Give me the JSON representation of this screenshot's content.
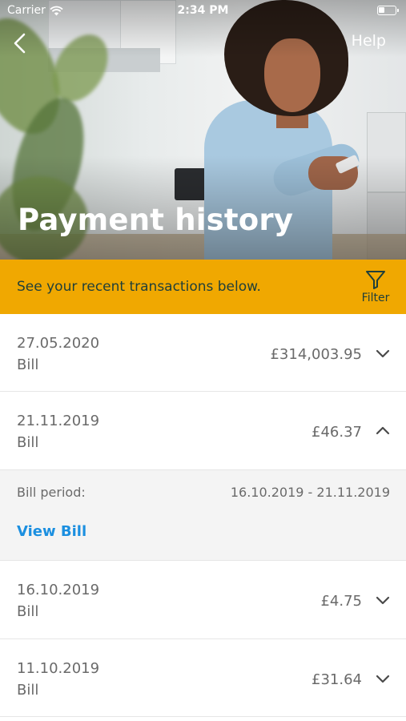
{
  "status_bar": {
    "carrier": "Carrier",
    "time": "2:34 PM"
  },
  "header": {
    "help_label": "Help",
    "title": "Payment history"
  },
  "banner": {
    "message": "See your recent transactions below.",
    "filter_label": "Filter"
  },
  "transactions": [
    {
      "date": "27.05.2020",
      "type": "Bill",
      "amount": "£314,003.95",
      "expanded": false
    },
    {
      "date": "21.11.2019",
      "type": "Bill",
      "amount": "£46.37",
      "expanded": true,
      "detail": {
        "period_label": "Bill period:",
        "period_value": "16.10.2019 - 21.11.2019",
        "link_label": "View Bill"
      }
    },
    {
      "date": "16.10.2019",
      "type": "Bill",
      "amount": "£4.75",
      "expanded": false
    },
    {
      "date": "11.10.2019",
      "type": "Bill",
      "amount": "£31.64",
      "expanded": false
    }
  ],
  "colors": {
    "banner": "#f0a801",
    "banner_text": "#1f3f3a",
    "link": "#1b8fe0",
    "detail_bg": "#f4f4f4"
  },
  "icons": {
    "back": "chevron-left-icon",
    "filter": "funnel-icon",
    "wifi": "wifi-icon",
    "battery": "battery-icon",
    "expand": "chevron-down-icon",
    "collapse": "chevron-up-icon"
  }
}
